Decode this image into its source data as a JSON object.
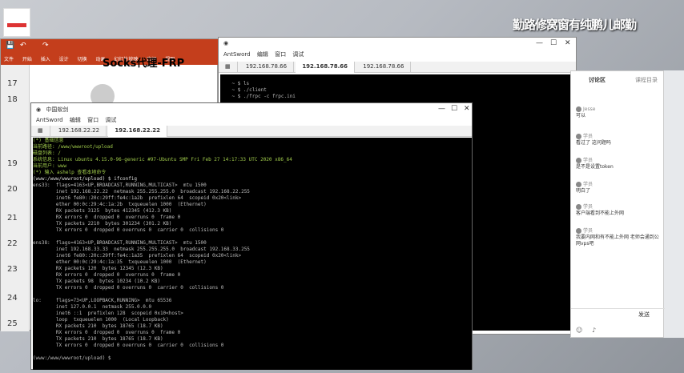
{
  "desktop": {
    "icon_label": "",
    "watermark": "勤路修窝窗有纯鹏儿邮勤"
  },
  "ppt": {
    "ribbon_tabs": [
      "文件",
      "开始",
      "插入",
      "设计",
      "切换",
      "动画",
      "幻灯片放映",
      "审阅",
      "视图"
    ],
    "slide_numbers": [
      "17",
      "18",
      "19",
      "20",
      "21",
      "22",
      "23",
      "24",
      "25"
    ],
    "slide_title": "Socks代理-FRP"
  },
  "ant2": {
    "title": "AntSword",
    "menu": [
      "AntSword",
      "编辑",
      "窗口",
      "调试"
    ],
    "tabs": [
      "192.168.78.66",
      "192.168.78.66",
      "192.168.78.66"
    ],
    "terminal_lines": [
      "~ $ ls",
      "~ $ ./client",
      "~ $ ./frpc -c frpc.ini",
      "  ...",
      "",
      "",
      "",
      "",
      "",
      "",
      "",
      "",
      "",
      "",
      "",
      "",
      ""
    ]
  },
  "ant1": {
    "title": "中国蚁剑",
    "menu": [
      "AntSword",
      "编辑",
      "窗口",
      "调试"
    ],
    "tabs": [
      "192.168.22.22",
      "192.168.22.22"
    ],
    "terminal_lines": [
      "(*) 基础信息",
      "当前路径: /www/wwwroot/upload",
      "磁盘列表: /",
      "系统信息: Linux ubuntu 4.15.0-96-generic #97-Ubuntu SMP Fri Feb 27 14:17:33 UTC 2020 x86_64",
      "当前用户: www",
      "(*) 输入 ashelp 查看本地命令",
      "(www:/www/wwwroot/upload) $ ifconfig",
      "ens33:  flags=4163<UP,BROADCAST,RUNNING,MULTICAST>  mtu 1500",
      "        inet 192.168.22.22  netmask 255.255.255.0  broadcast 192.168.22.255",
      "        inet6 fe80::20c:29ff:fe4c:1a2b  prefixlen 64  scopeid 0x20<link>",
      "        ether 00:0c:29:4c:1a:2b  txqueuelen 1000  (Ethernet)",
      "        RX packets 3125  bytes 412345 (412.3 KB)",
      "        RX errors 0  dropped 0  overruns 0  frame 0",
      "        TX packets 2210  bytes 301234 (301.2 KB)",
      "        TX errors 0  dropped 0 overruns 0  carrier 0  collisions 0",
      "",
      "ens38:  flags=4163<UP,BROADCAST,RUNNING,MULTICAST>  mtu 1500",
      "        inet 192.168.33.33  netmask 255.255.255.0  broadcast 192.168.33.255",
      "        inet6 fe80::20c:29ff:fe4c:1a35  prefixlen 64  scopeid 0x20<link>",
      "        ether 00:0c:29:4c:1a:35  txqueuelen 1000  (Ethernet)",
      "        RX packets 120  bytes 12345 (12.3 KB)",
      "        RX errors 0  dropped 0  overruns 0  frame 0",
      "        TX packets 98  bytes 10234 (10.2 KB)",
      "        TX errors 0  dropped 0 overruns 0  carrier 0  collisions 0",
      "",
      "lo:     flags=73<UP,LOOPBACK,RUNNING>  mtu 65536",
      "        inet 127.0.0.1  netmask 255.0.0.0",
      "        inet6 ::1  prefixlen 128  scopeid 0x10<host>",
      "        loop  txqueuelen 1000  (Local Loopback)",
      "        RX packets 210  bytes 18765 (18.7 KB)",
      "        RX errors 0  dropped 0  overruns 0  frame 0",
      "        TX packets 210  bytes 18765 (18.7 KB)",
      "        TX errors 0  dropped 0 overruns 0  carrier 0  collisions 0",
      "",
      "(www:/www/wwwroot/upload) $"
    ]
  },
  "chat": {
    "tab_discuss": "讨论区",
    "tab_other": "课程目录",
    "items": [
      {
        "name": "Jesse",
        "text": "可以"
      },
      {
        "name": "学员",
        "text": "看过了 这问题吗"
      },
      {
        "name": "学员",
        "text": "是不是设置token"
      },
      {
        "name": "学员",
        "text": "明白了"
      },
      {
        "name": "学员",
        "text": "客户端看到不能上外网"
      },
      {
        "name": "学员",
        "text": "我要内网和有不能上外网 老师会通到公网vps吧"
      }
    ],
    "send_label": "发送"
  }
}
